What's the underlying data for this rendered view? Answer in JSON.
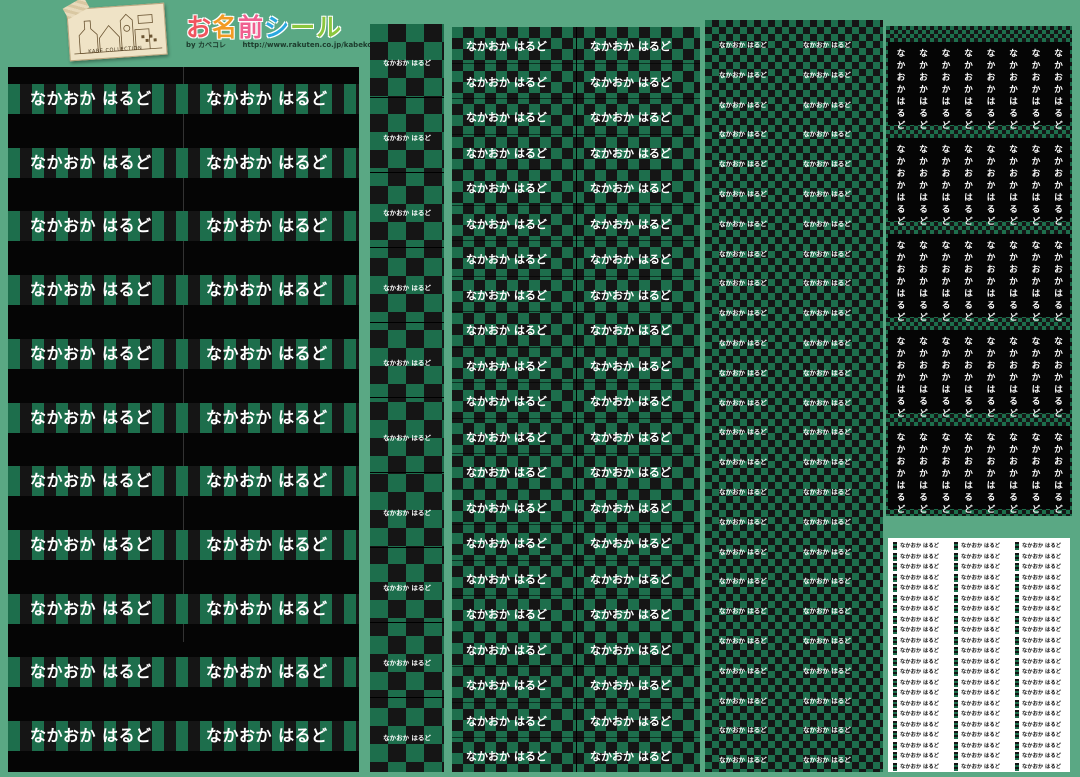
{
  "header": {
    "sketch_caption": "KABE COLLECTION",
    "title_chars": [
      {
        "ch": "お",
        "color": "#f0555f"
      },
      {
        "ch": "名",
        "color": "#f29b24"
      },
      {
        "ch": "前",
        "color": "#f06090"
      },
      {
        "ch": "シ",
        "color": "#2ba8df"
      },
      {
        "ch": "ー",
        "color": "#8cc63e"
      },
      {
        "ch": "ル",
        "color": "#8cc63e"
      }
    ],
    "byline": "by カベコレ",
    "url": "http://www.rakuten.co.jp/kabekore/"
  },
  "label_name": "なかおか はるど",
  "colors": {
    "background": "#5aa884",
    "checker_green": "#1d6e4c",
    "checker_black": "#151515",
    "label_black": "#050505",
    "white": "#ffffff"
  },
  "sheets": {
    "large_labels": {
      "rows": 11,
      "columns": 2
    },
    "strip_labels": {
      "count": 10
    },
    "medium_labels": {
      "rows": 21,
      "columns": 2
    },
    "small_labels": {
      "rows": 25,
      "columns": 2
    },
    "vertical_labels": {
      "blocks": 5,
      "columns": 8
    },
    "mini_labels": {
      "rows": 22,
      "columns": 3
    }
  }
}
